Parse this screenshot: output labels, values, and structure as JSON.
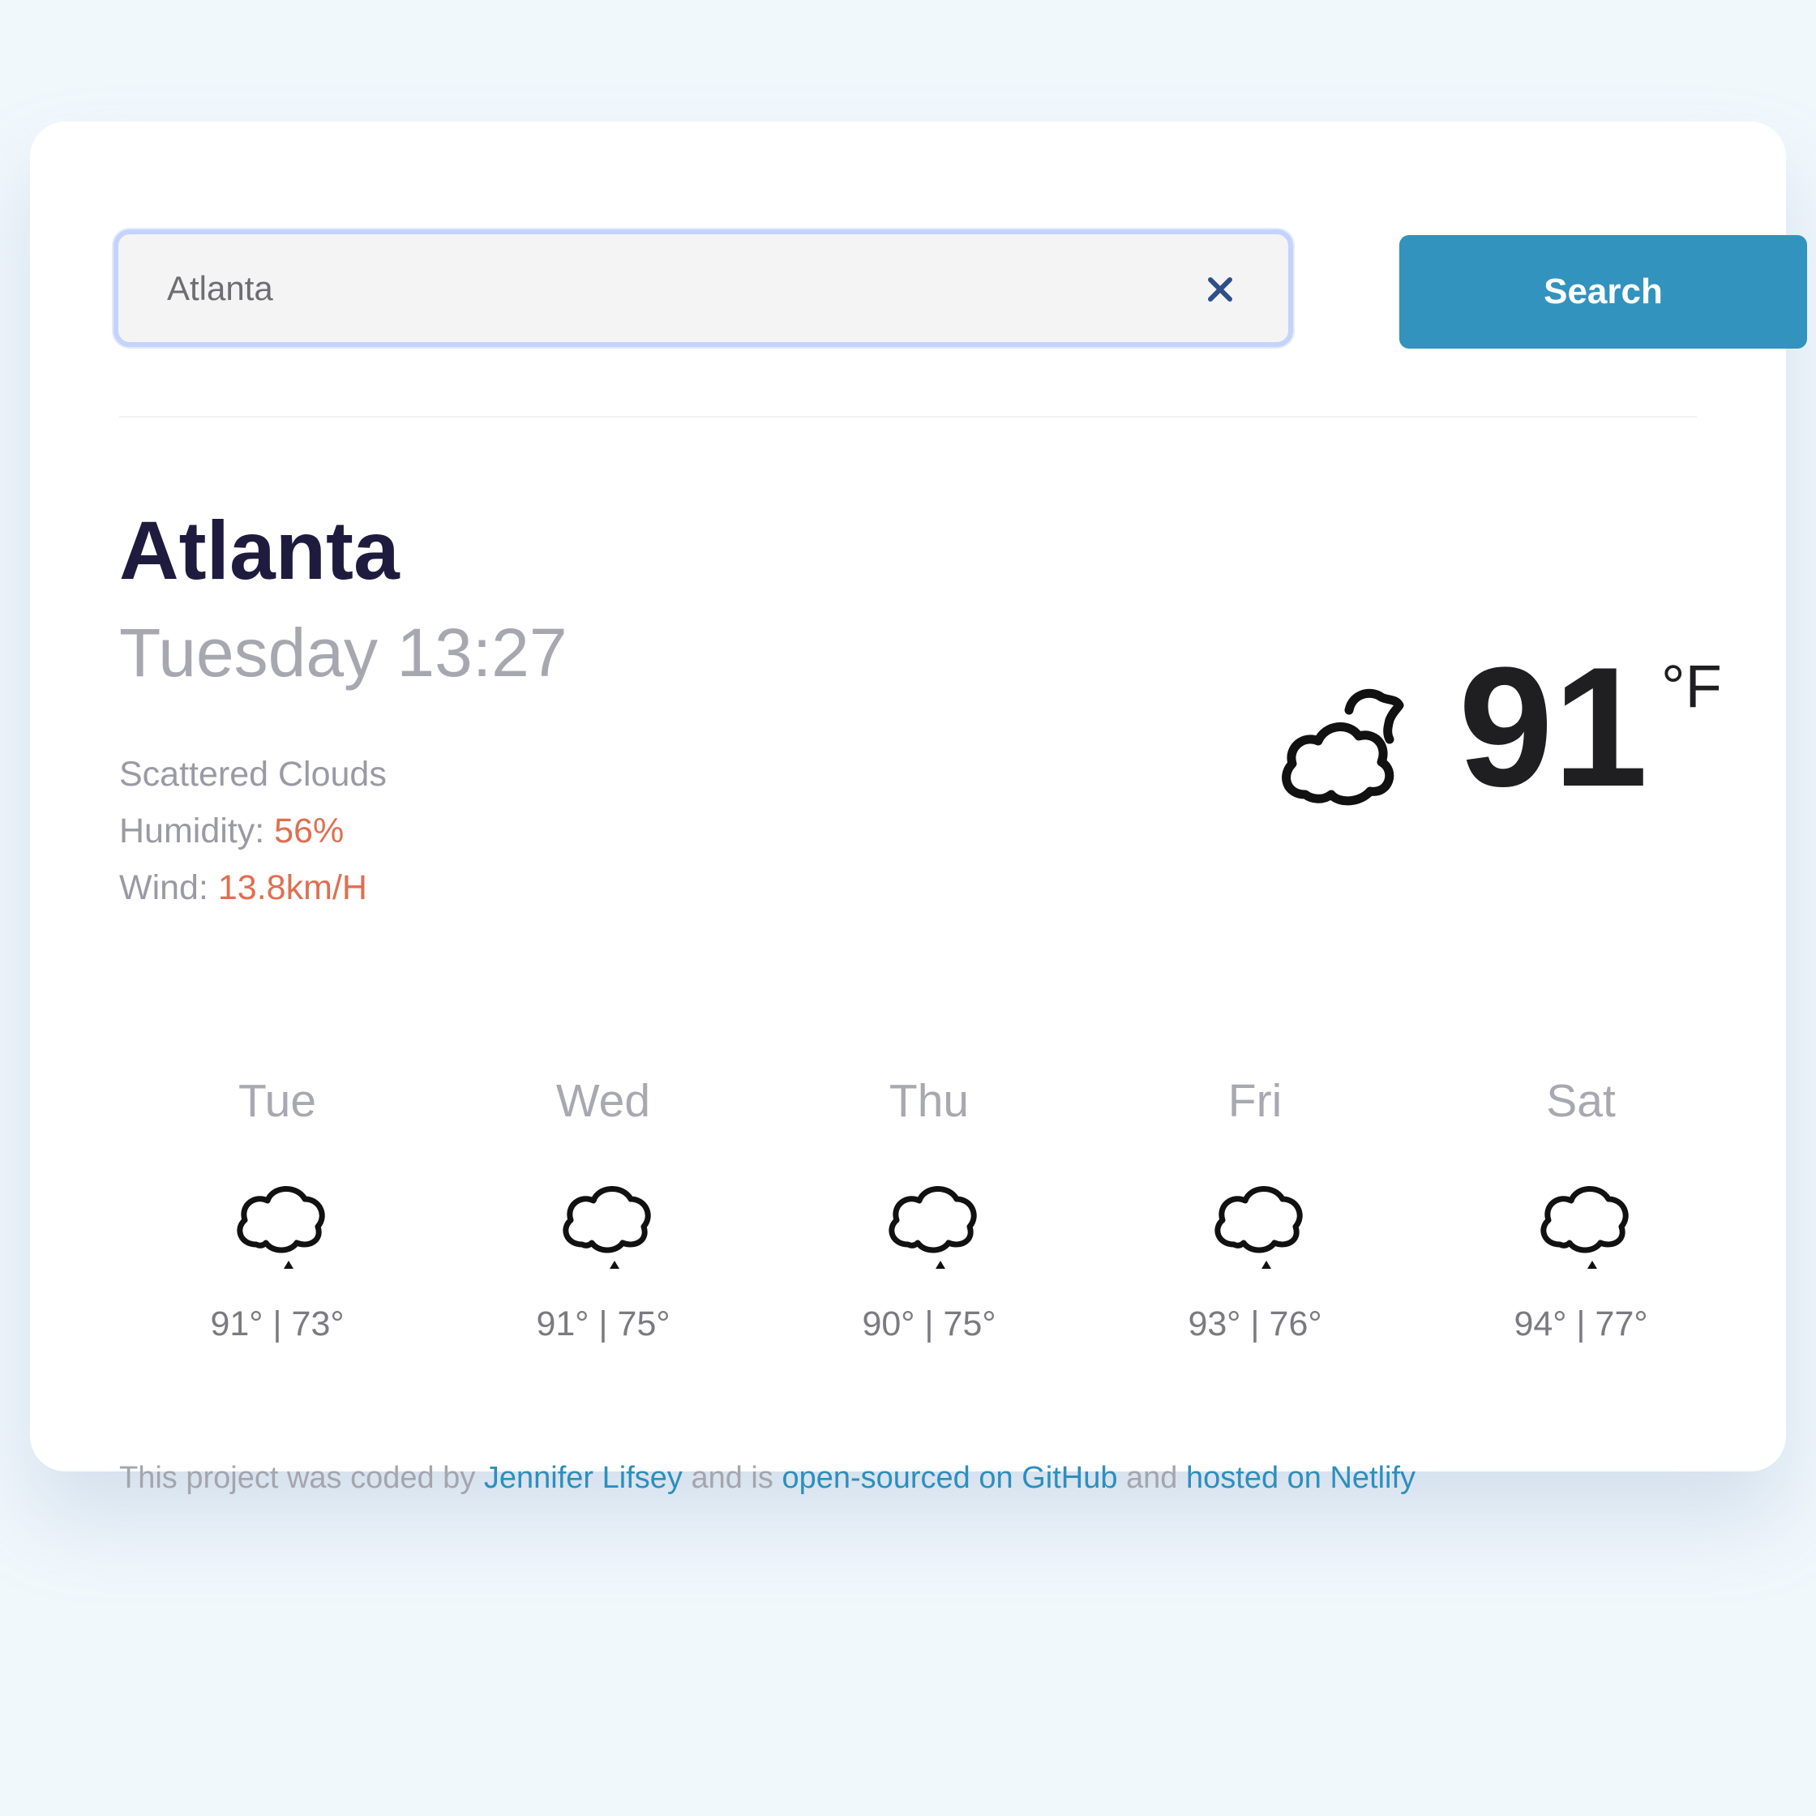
{
  "search": {
    "value": "Atlanta",
    "button_label": "Search"
  },
  "current": {
    "city": "Atlanta",
    "datetime": "Tuesday 13:27",
    "description": "Scattered Clouds",
    "humidity_label": "Humidity:",
    "humidity_value": "56%",
    "wind_label": "Wind:",
    "wind_value": "13.8km/H",
    "temperature": "91",
    "unit": "°F",
    "icon": "partly-cloudy-icon"
  },
  "forecast": [
    {
      "day": "Tue",
      "temps": "91° | 73°",
      "icon": "rain-cloud-icon"
    },
    {
      "day": "Wed",
      "temps": "91° | 75°",
      "icon": "rain-cloud-icon"
    },
    {
      "day": "Thu",
      "temps": "90° | 75°",
      "icon": "rain-cloud-icon"
    },
    {
      "day": "Fri",
      "temps": "93° | 76°",
      "icon": "rain-cloud-icon"
    },
    {
      "day": "Sat",
      "temps": "94° | 77°",
      "icon": "rain-cloud-icon"
    }
  ],
  "footer": {
    "text_1": "This project was coded by ",
    "author_link": "Jennifer Lifsey",
    "text_2": " and is ",
    "github_link": "open-sourced on GitHub",
    "text_3": " and ",
    "netlify_link": "hosted on Netlify"
  },
  "colors": {
    "accent": "#3293be",
    "highlight": "#df6f51",
    "heading": "#1e1b3f"
  }
}
